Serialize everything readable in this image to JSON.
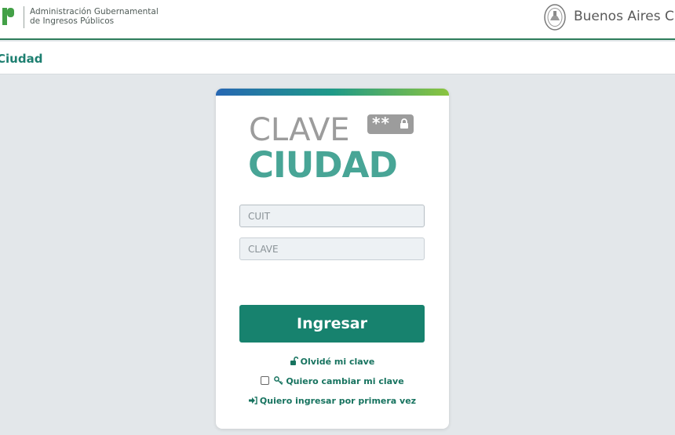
{
  "header": {
    "agency_line1": "Administración Gubernamental",
    "agency_line2": "de Ingresos Públicos",
    "city_name": "Buenos Aires Ci"
  },
  "subheader": {
    "title": "Ciudad"
  },
  "brand": {
    "word1": "CLAVE",
    "badge": "**",
    "word2": "CIUDAD"
  },
  "form": {
    "cuit_placeholder": "CUIT",
    "clave_placeholder": "CLAVE",
    "submit_label": "Ingresar"
  },
  "links": {
    "forgot": "Olvidé mi clave",
    "change": "Quiero cambiar mi clave",
    "first_time": "Quiero ingresar por primera vez"
  },
  "colors": {
    "brand_green": "#17826e",
    "link_green": "#17735f",
    "gray_logo": "#9c9c9c",
    "teal_logo": "#48a596",
    "background": "#e3e7ea"
  },
  "icons": {
    "agency_logo": "agip-logo",
    "city_seal": "buenos-aires-seal-icon",
    "badge_lock": "lock-icon",
    "forgot": "unlock-icon",
    "change": "key-icon",
    "first_time": "sign-in-icon"
  }
}
